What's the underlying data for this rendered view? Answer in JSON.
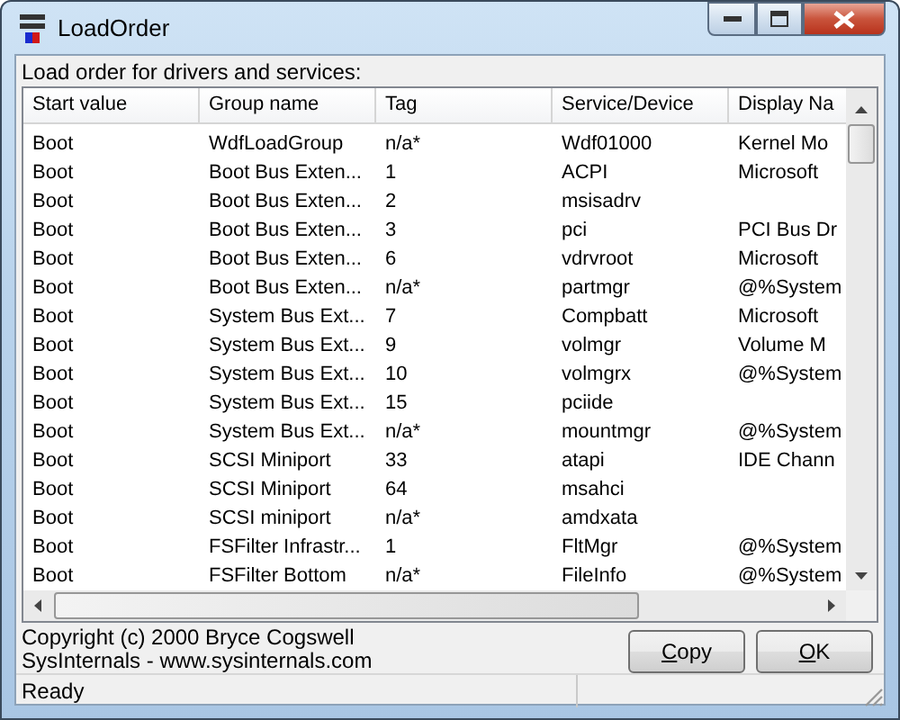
{
  "window": {
    "title": "LoadOrder"
  },
  "caption": "Load order for drivers and services:",
  "table": {
    "columns": [
      "Start value",
      "Group name",
      "Tag",
      "Service/Device",
      "Display Na"
    ],
    "rows": [
      {
        "start": "Boot",
        "group": "WdfLoadGroup",
        "tag": "n/a*",
        "service": "Wdf01000",
        "display": "Kernel Mo"
      },
      {
        "start": "Boot",
        "group": "Boot Bus Exten...",
        "tag": "1",
        "service": "ACPI",
        "display": "Microsoft"
      },
      {
        "start": "Boot",
        "group": "Boot Bus Exten...",
        "tag": "2",
        "service": "msisadrv"
      },
      {
        "start": "Boot",
        "group": "Boot Bus Exten...",
        "tag": "3",
        "service": "pci",
        "display": "PCI Bus Dr"
      },
      {
        "start": "Boot",
        "group": "Boot Bus Exten...",
        "tag": "6",
        "service": "vdrvroot",
        "display": "Microsoft"
      },
      {
        "start": "Boot",
        "group": "Boot Bus Exten...",
        "tag": "n/a*",
        "service": "partmgr",
        "display": "@%System"
      },
      {
        "start": "Boot",
        "group": "System Bus Ext...",
        "tag": "7",
        "service": "Compbatt",
        "display": "Microsoft"
      },
      {
        "start": "Boot",
        "group": "System Bus Ext...",
        "tag": "9",
        "service": "volmgr",
        "display": "Volume M"
      },
      {
        "start": "Boot",
        "group": "System Bus Ext...",
        "tag": "10",
        "service": "volmgrx",
        "display": "@%System"
      },
      {
        "start": "Boot",
        "group": "System Bus Ext...",
        "tag": "15",
        "service": "pciide"
      },
      {
        "start": "Boot",
        "group": "System Bus Ext...",
        "tag": "n/a*",
        "service": "mountmgr",
        "display": "@%System"
      },
      {
        "start": "Boot",
        "group": "SCSI Miniport",
        "tag": "33",
        "service": "atapi",
        "display": "IDE Chann"
      },
      {
        "start": "Boot",
        "group": "SCSI Miniport",
        "tag": "64",
        "service": "msahci"
      },
      {
        "start": "Boot",
        "group": "SCSI miniport",
        "tag": "n/a*",
        "service": "amdxata"
      },
      {
        "start": "Boot",
        "group": "FSFilter Infrastr...",
        "tag": "1",
        "service": "FltMgr",
        "display": "@%System"
      },
      {
        "start": "Boot",
        "group": "FSFilter Bottom",
        "tag": "n/a*",
        "service": "FileInfo",
        "display": "@%System"
      }
    ]
  },
  "footer": {
    "lines": [
      "Copyright (c) 2000 Bryce Cogswell",
      "SysInternals - www.sysinternals.com"
    ]
  },
  "buttons": [
    "Copy",
    "OK"
  ],
  "status_bar": {
    "text": "Ready"
  }
}
